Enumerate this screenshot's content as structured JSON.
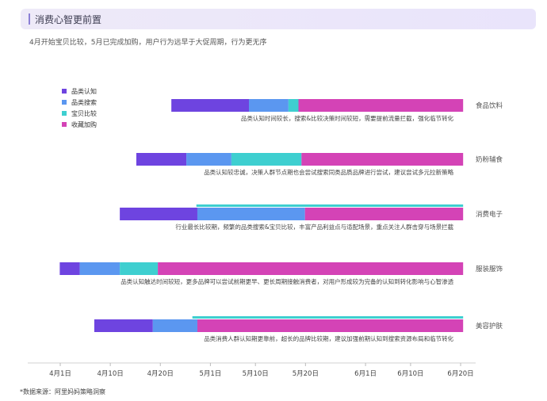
{
  "header": {
    "title": "消费心智更前置"
  },
  "subtitle": "4月开始宝贝比较，5月已完成加购，用户行为远早于大促周期，行为更无序",
  "footnote": "*数据来源：阿里妈妈策略洞察",
  "colors": {
    "品类认知": "#6e44e0",
    "品类搜索": "#5b97f0",
    "宝贝比较": "#3ecfd0",
    "收藏加购": "#d443b6"
  },
  "chart_data": {
    "type": "bar",
    "orientation": "horizontal-stacked-gantt",
    "legend": {
      "position": "top-left",
      "entries": [
        "品类认知",
        "品类搜索",
        "宝贝比较",
        "收藏加购"
      ]
    },
    "x_axis": {
      "ticks": [
        "4月1日",
        "4月10日",
        "4月20日",
        "5月1日",
        "5月10日",
        "5月20日",
        "6月1日",
        "6月10日",
        "6月20日"
      ],
      "range": [
        "3月31日",
        "6月21日"
      ]
    },
    "categories": [
      {
        "name": "食品饮料",
        "segments": [
          {
            "phase": "品类认知",
            "start": 22.2,
            "end": 37.7
          },
          {
            "phase": "品类搜索",
            "start": 37.7,
            "end": 45.6
          },
          {
            "phase": "宝贝比较",
            "start": 45.6,
            "end": 47.6
          },
          {
            "phase": "收藏加购",
            "start": 47.6,
            "end": 80.5
          }
        ],
        "note": "品类认知时间较长，搜索&比较决策时间较短，需要提前流量拦截，强化临节转化"
      },
      {
        "name": "奶粉辅食",
        "segments": [
          {
            "phase": "品类认知",
            "start": 15.2,
            "end": 25.2
          },
          {
            "phase": "品类搜索",
            "start": 25.2,
            "end": 34.2
          },
          {
            "phase": "宝贝比较",
            "start": 34.2,
            "end": 48.2
          },
          {
            "phase": "收藏加购",
            "start": 48.2,
            "end": 80.5
          }
        ],
        "note": "品类认知较忠诚，决策人群节点期也会尝试搜索同类品质品牌进行尝试，建议尝试多元拉新策略"
      },
      {
        "name": "消费电子",
        "segments": [
          {
            "phase": "品类认知",
            "start": 11.9,
            "end": 27.4
          },
          {
            "phase": "品类搜索",
            "start": 27.4,
            "end": 48.9
          },
          {
            "phase": "收藏加购",
            "start": 48.9,
            "end": 80.5
          }
        ],
        "overlay": {
          "phase": "宝贝比较",
          "start": 27.2,
          "end": 80.5
        },
        "note": "行业最长比较期，频繁的品类搜索&宝贝比较，丰富产品利益点与适配场景，重点关注人群击穿与场景拦截"
      },
      {
        "name": "服装服饰",
        "segments": [
          {
            "phase": "品类认知",
            "start": -0.1,
            "end": 3.9
          },
          {
            "phase": "品类搜索",
            "start": 3.9,
            "end": 11.9
          },
          {
            "phase": "宝贝比较",
            "start": 11.9,
            "end": 19.5
          },
          {
            "phase": "收藏加购",
            "start": 19.5,
            "end": 80.5
          }
        ],
        "note": "品类认知触达时间较短，更多品牌可以尝试前期更早、更长周期接触消费者，对用户形成较为完备的认知到转化影响与心智渗透"
      },
      {
        "name": "美容护肤",
        "segments": [
          {
            "phase": "品类认知",
            "start": 6.8,
            "end": 18.5
          },
          {
            "phase": "品类搜索",
            "start": 18.5,
            "end": 27.4
          },
          {
            "phase": "收藏加购",
            "start": 27.4,
            "end": 80.5
          }
        ],
        "overlay": {
          "phase": "宝贝比较",
          "start": 26.4,
          "end": 80.5
        },
        "note": "品类消费人群认知期更靠前，超长的品牌比较期，建议加强前期认知到搜索资源布局和临节转化"
      }
    ]
  }
}
